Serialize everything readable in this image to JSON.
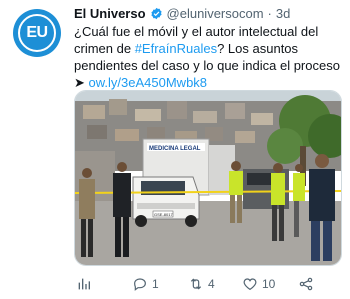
{
  "tweet": {
    "author": {
      "avatar_text": "EU",
      "display_name": "El Universo",
      "handle": "@eluniversocom",
      "time": "3d",
      "separator": "·"
    },
    "text": {
      "line_part1": "¿Cuál fue el móvil y el autor intelectual del crimen de ",
      "hashtag": "#EfraínRuales",
      "line_part2": "? Los asuntos pendientes del caso y lo que indica el proceso ➤ ",
      "link": "ow.ly/3eA450Mwbk8"
    },
    "media": {
      "truck_label": "MEDICINA LEGAL",
      "plate": "GSE-8017"
    },
    "actions": {
      "replies": "1",
      "retweets": "4",
      "likes": "10"
    }
  },
  "colors": {
    "brand_blue": "#1d8fd6",
    "link": "#1d9bf0",
    "muted": "#536471"
  },
  "icons": [
    "verified-badge-icon",
    "analytics-icon",
    "reply-icon",
    "retweet-icon",
    "like-icon",
    "share-icon"
  ]
}
